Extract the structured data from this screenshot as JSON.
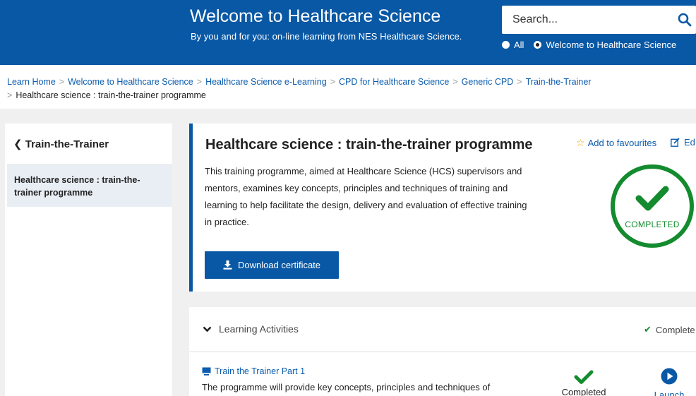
{
  "header": {
    "title": "Welcome to Healthcare Science",
    "subtitle": "By you and for you: on-line learning from NES Healthcare Science.",
    "search_placeholder": "Search...",
    "scope_all": "All",
    "scope_site": "Welcome to Healthcare Science",
    "selected_scope": "Welcome to Healthcare Science"
  },
  "breadcrumb": {
    "items": [
      "Learn Home",
      "Welcome to Healthcare Science",
      "Healthcare Science e-Learning",
      "CPD for Healthcare Science",
      "Generic CPD",
      "Train-the-Trainer"
    ],
    "current": "Healthcare science : train-the-trainer programme"
  },
  "sidebar": {
    "back_label": "Train-the-Trainer",
    "active_item": "Healthcare science : train-the-trainer programme"
  },
  "course": {
    "title": "Healthcare science : train-the-trainer programme",
    "description": "This training programme, aimed at Healthcare Science (HCS) supervisors and mentors, examines key concepts, principles and techniques of training and learning to help facilitate the design, delivery and evaluation of effective training in practice.",
    "favourite_label": "Add to favourites",
    "edit_label": "Ed",
    "status_badge": "COMPLETED",
    "download_label": "Download certificate"
  },
  "activities": {
    "section_label": "Learning Activities",
    "section_status": "Complete",
    "items": [
      {
        "title": "Train the Trainer Part 1",
        "description": "The programme will provide key concepts, principles and techniques of",
        "status": "Completed",
        "action": "Launch"
      }
    ]
  },
  "colors": {
    "brand_blue": "#0958a5",
    "link_blue": "#0b5cad",
    "success_green": "#138b2e",
    "star_gold": "#e6a817"
  }
}
